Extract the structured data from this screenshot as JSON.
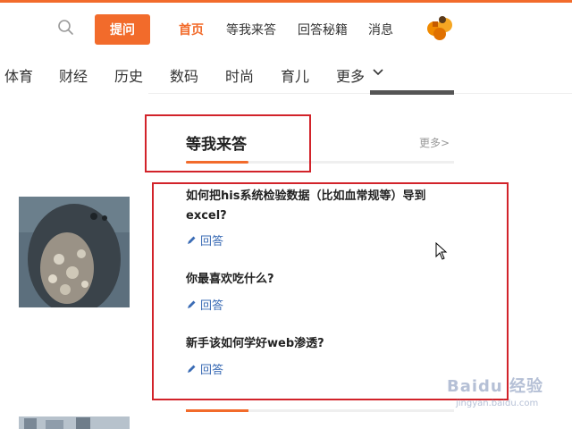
{
  "header": {
    "ask_button": "提问",
    "nav": [
      "首页",
      "等我来答",
      "回答秘籍",
      "消息"
    ],
    "active_nav": "首页"
  },
  "categories": [
    "体育",
    "财经",
    "历史",
    "数码",
    "时尚",
    "育儿",
    "更多"
  ],
  "section": {
    "title": "等我来答",
    "more": "更多>"
  },
  "questions": [
    {
      "line1": "如何把his系统检验数据（比如血常规等）导到",
      "line2": "excel?",
      "answer_label": "回答"
    },
    {
      "line1": "你最喜欢吃什么?",
      "line2": "",
      "answer_label": "回答"
    },
    {
      "line1": "新手该如何学好web渗透?",
      "line2": "",
      "answer_label": "回答"
    }
  ],
  "watermark": {
    "brand": "Baidu 经验",
    "url": "jingyan.baidu.com"
  },
  "colors": {
    "accent": "#f26b2b",
    "link": "#3b6cb5",
    "highlight_box": "#d2232a"
  },
  "icons": [
    "search-icon",
    "avatar-icon",
    "chevron-down-icon",
    "pencil-icon",
    "cursor-icon"
  ]
}
